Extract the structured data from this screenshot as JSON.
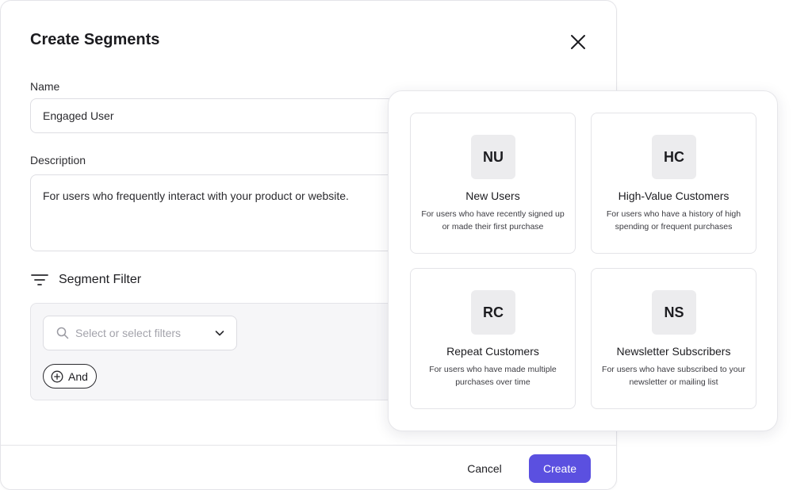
{
  "modal": {
    "title": "Create Segments",
    "name_label": "Name",
    "name_value": "Engaged User",
    "description_label": "Description",
    "description_value": "For users who frequently interact with your product or website.",
    "filter_title": "Segment Filter",
    "filter_placeholder": "Select or select filters",
    "and_label": "And",
    "cancel_label": "Cancel",
    "create_label": "Create"
  },
  "templates": [
    {
      "badge": "NU",
      "title": "New Users",
      "description": "For users who have recently signed up or made their first purchase"
    },
    {
      "badge": "HC",
      "title": "High-Value Customers",
      "description": "For users who have a history of high spending or frequent purchases"
    },
    {
      "badge": "RC",
      "title": "Repeat Customers",
      "description": "For users who have made multiple purchases over time"
    },
    {
      "badge": "NS",
      "title": "Newsletter Subscribers",
      "description": "For users who have subscribed to your newsletter or mailing list"
    }
  ],
  "colors": {
    "primary": "#5b50e0",
    "badge_bg": "#ececee",
    "panel_bg": "#f6f6f8",
    "border": "#e4e4e8"
  },
  "icons": {
    "close": "close-icon",
    "filter": "filter-lines-icon",
    "search": "search-icon",
    "dropdown": "chevron-down-icon",
    "add": "plus-circle-icon"
  }
}
